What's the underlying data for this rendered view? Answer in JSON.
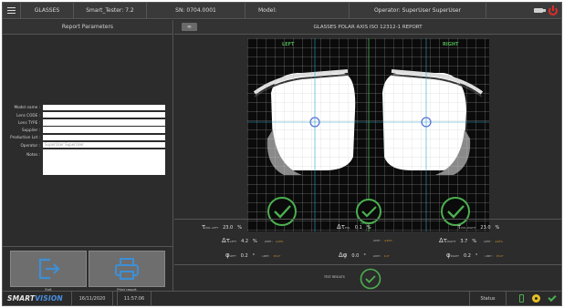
{
  "header": {
    "app_name": "GLASSES",
    "version": "Smart_Tester: 7.2",
    "serial": "SN: 0704.0001",
    "model": "Model:",
    "operator": "Operator: SuperUser SuperUser"
  },
  "left_panel": {
    "title": "Report Parameters",
    "fields": [
      {
        "label": "Model name :",
        "value": ""
      },
      {
        "label": "Lens CODE :",
        "value": ""
      },
      {
        "label": "Lens TYPE :",
        "value": ""
      },
      {
        "label": "Supplier :",
        "value": ""
      },
      {
        "label": "Production Lot :",
        "value": ""
      },
      {
        "label": "Operator :",
        "value": "SuperUser SuperUser"
      }
    ],
    "notes_label": "Notes :",
    "exit_label": "Exit",
    "print_label": "Print report"
  },
  "report": {
    "title": "GLASSES POLAR AXIS ISO 12312-1 REPORT",
    "glasses_button_icon": "glasses-icon",
    "left_label": "LEFT",
    "right_label": "RIGHT",
    "center_label": "BINOCULAR"
  },
  "measurements": {
    "tau_left": {
      "symbol": "τ",
      "sub": "POL LEFT",
      "value": "23.0",
      "unit": "%"
    },
    "dtau": {
      "symbol": "Δτ",
      "sub": "POL",
      "value": "0.1",
      "unit": "%"
    },
    "tau_right": {
      "symbol": "τ",
      "sub": "POL RIGHT",
      "value": "23.0",
      "unit": "%"
    },
    "dtau_left": {
      "symbol": "Δτ",
      "sub": "LEFT",
      "value": "4.2",
      "unit": "%",
      "limit_label": "LIMIT :",
      "limit": "≤10%"
    },
    "dtau_mid": {
      "limit_label": "LIMIT :",
      "limit": "≤10%"
    },
    "dtau_right": {
      "symbol": "Δτ",
      "sub": "RIGHT",
      "value": "3.7",
      "unit": "%",
      "limit_label": "LIMIT :",
      "limit": "≤10%"
    },
    "phi_left": {
      "symbol": "φ",
      "sub": "LEFT",
      "value": "0.2",
      "unit": "°",
      "limit_label": "LIMIT :",
      "limit": "±5.0°"
    },
    "dphi": {
      "symbol": "Δφ",
      "sub": "",
      "value": "0.0",
      "unit": "°",
      "limit_label": "LIMIT :",
      "limit": "6.0°"
    },
    "phi_right": {
      "symbol": "φ",
      "sub": "RIGHT",
      "value": "0.2",
      "unit": "°",
      "limit_label": "LIMIT :",
      "limit": "±5.0°"
    }
  },
  "result": {
    "label": "TEST RESULTS"
  },
  "status_bar": {
    "logo_part1": "SMART",
    "logo_part2": "VISION",
    "date": "16/11/2020",
    "time": "11:57:06",
    "status_label": "Status"
  },
  "colors": {
    "background": "#2c2c2c",
    "pass_green": "#4caf50",
    "crosshair_cyan": "#2ea3c7",
    "target_blue": "#3b5bd1",
    "limit_orange": "#d99a2b",
    "power_red": "#e02b2b"
  }
}
